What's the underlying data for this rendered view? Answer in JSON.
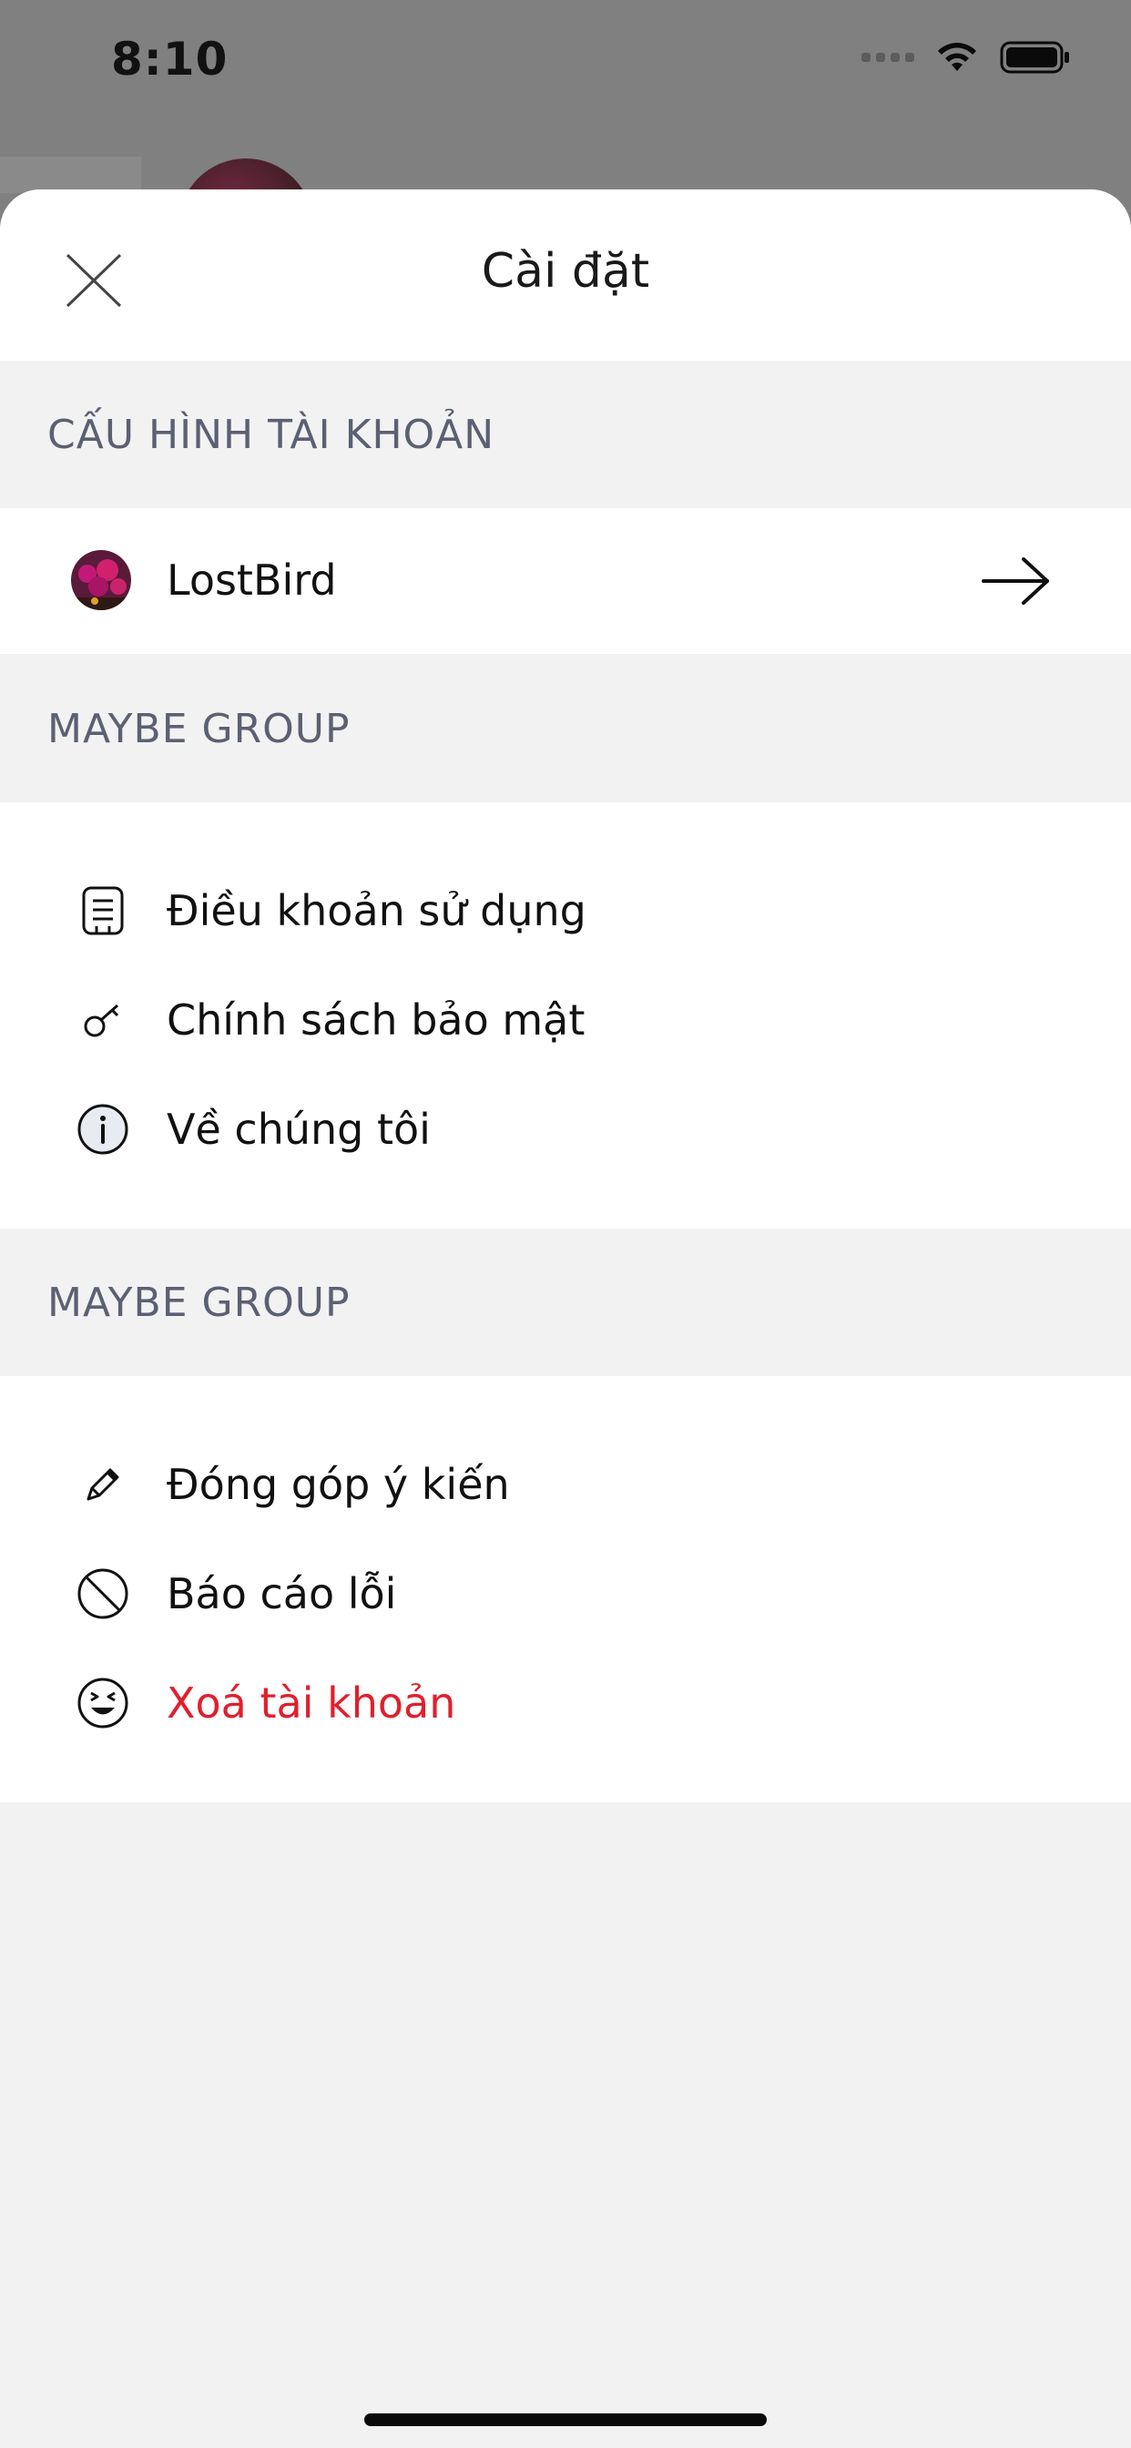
{
  "status_bar": {
    "time": "8:10"
  },
  "sheet": {
    "title": "Cài đặt",
    "sections": [
      {
        "label": "CẤU HÌNH TÀI KHOẢN"
      },
      {
        "label": "MAYBE GROUP"
      },
      {
        "label": "MAYBE GROUP"
      }
    ],
    "account": {
      "name": "LostBird"
    },
    "group1": [
      {
        "label": "Điều khoản sử dụng",
        "icon": "document-icon"
      },
      {
        "label": "Chính sách bảo mật",
        "icon": "key-icon"
      },
      {
        "label": "Về chúng tôi",
        "icon": "info-icon"
      }
    ],
    "group2": [
      {
        "label": "Đóng góp ý kiến",
        "icon": "pencil-icon"
      },
      {
        "label": "Báo cáo lỗi",
        "icon": "block-icon"
      },
      {
        "label": "Xoá tài khoản",
        "icon": "face-icon",
        "color": "#e0202e"
      }
    ]
  },
  "colors": {
    "danger": "#e0202e",
    "section_text": "#5b6072",
    "sheet_bg": "#f2f2f2"
  }
}
